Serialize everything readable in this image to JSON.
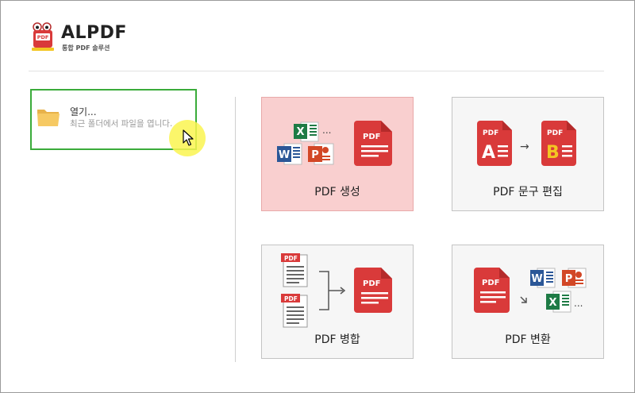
{
  "app": {
    "logo_text": "PDF",
    "brand": "ALPDF",
    "tagline": "통합 PDF 솔루션"
  },
  "open": {
    "title": "열기...",
    "subtitle": "최근 폴더에서 파일을 엽니다."
  },
  "tiles": [
    {
      "label": "PDF 생성",
      "active": true
    },
    {
      "label": "PDF 문구 편집",
      "active": false
    },
    {
      "label": "PDF 병합",
      "active": false
    },
    {
      "label": "PDF 변환",
      "active": false
    }
  ],
  "icons": {
    "pdf_badge": "PDF",
    "excel_letter": "X",
    "word_letter": "W",
    "ppt_letter": "P",
    "ellipsis": "...",
    "letter_a": "A",
    "letter_b": "B",
    "arrow": "→"
  },
  "colors": {
    "pdf_red": "#d93a3a",
    "pdf_red_dark": "#b52a2a",
    "excel_green": "#1e7b45",
    "word_blue": "#2b5797",
    "ppt_orange": "#d24726",
    "accent_green": "#3aab3a",
    "active_tile": "#f9cfcf",
    "letter_yellow": "#f3c623"
  }
}
